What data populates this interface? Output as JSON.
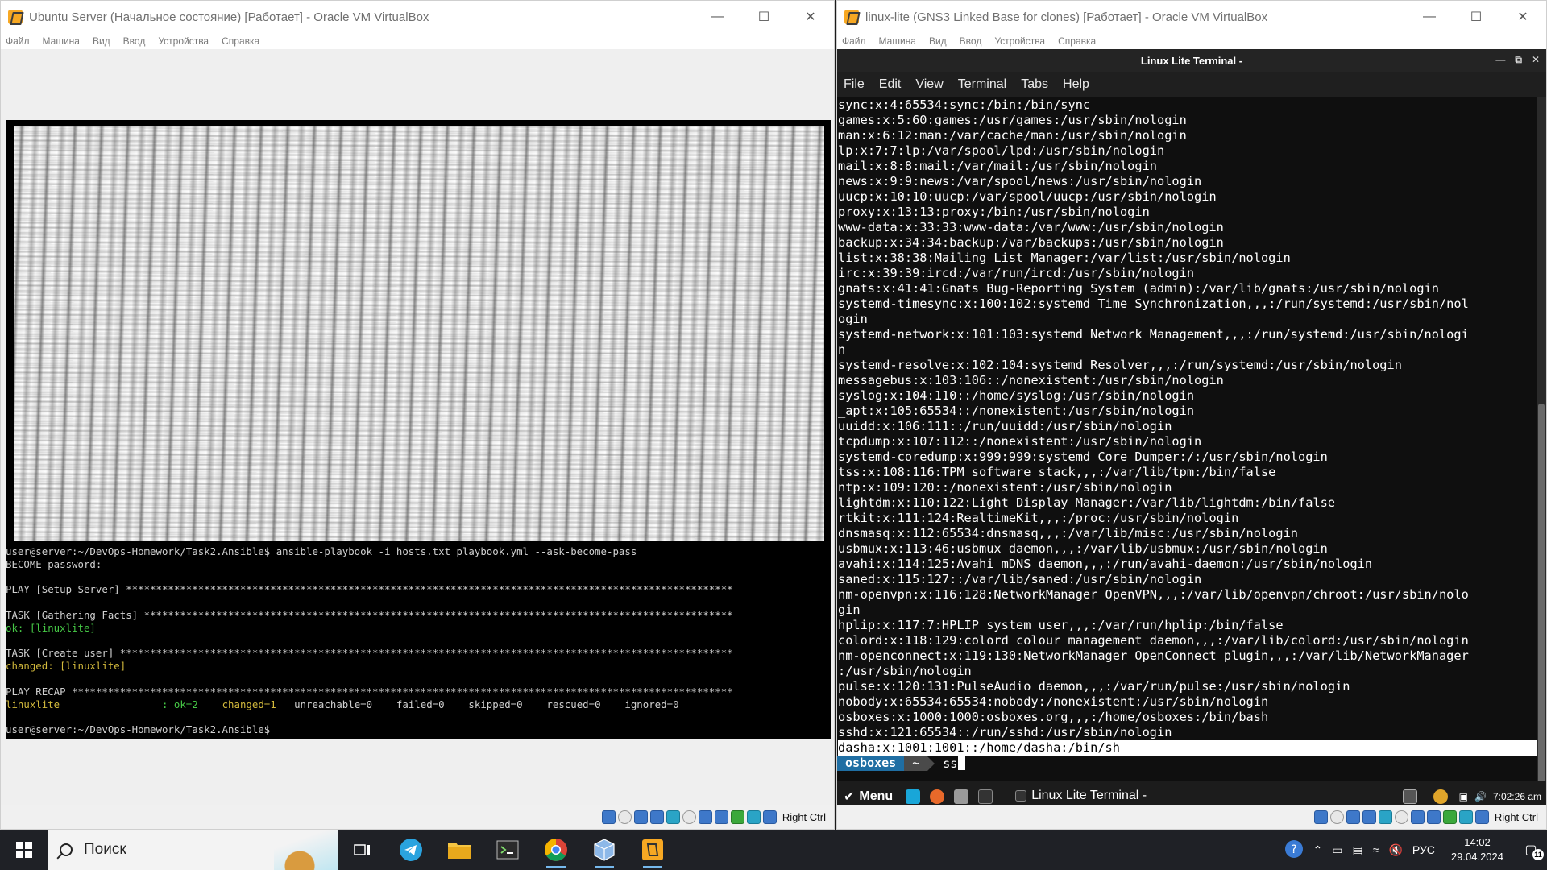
{
  "left_window": {
    "title": "Ubuntu Server (Начальное состояние) [Работает] - Oracle VM VirtualBox",
    "menu": [
      "Файл",
      "Машина",
      "Вид",
      "Ввод",
      "Устройства",
      "Справка"
    ],
    "status_host_key": "Right Ctrl",
    "console": {
      "line1_prompt": "user@server:~/DevOps-Homework/Task2.Ansible$ ansible-playbook -i hosts.txt playbook.yml --ask-become-pass",
      "line2": "BECOME password:",
      "play": "PLAY [Setup Server] *****************************************************************************************************",
      "task1": "TASK [Gathering Facts] **************************************************************************************************",
      "task1_result": "ok: [linuxlite]",
      "task2": "TASK [Create user] ******************************************************************************************************",
      "task2_result": "changed: [linuxlite]",
      "recap": "PLAY RECAP **************************************************************************************************************",
      "recap_host": "linuxlite",
      "recap_ok": ": ok=2",
      "recap_changed": "changed=1",
      "recap_rest": "   unreachable=0    failed=0    skipped=0    rescued=0    ignored=0",
      "final_prompt": "user@server:~/DevOps-Homework/Task2.Ansible$ "
    }
  },
  "right_window": {
    "title": "linux-lite (GNS3 Linked Base for clones) [Работает] - Oracle VM VirtualBox",
    "menu": [
      "Файл",
      "Машина",
      "Вид",
      "Ввод",
      "Устройства",
      "Справка"
    ],
    "status_host_key": "Right Ctrl",
    "terminal": {
      "title": "Linux Lite Terminal -",
      "menu": [
        "File",
        "Edit",
        "View",
        "Terminal",
        "Tabs",
        "Help"
      ],
      "lines": [
        "sync:x:4:65534:sync:/bin:/bin/sync",
        "games:x:5:60:games:/usr/games:/usr/sbin/nologin",
        "man:x:6:12:man:/var/cache/man:/usr/sbin/nologin",
        "lp:x:7:7:lp:/var/spool/lpd:/usr/sbin/nologin",
        "mail:x:8:8:mail:/var/mail:/usr/sbin/nologin",
        "news:x:9:9:news:/var/spool/news:/usr/sbin/nologin",
        "uucp:x:10:10:uucp:/var/spool/uucp:/usr/sbin/nologin",
        "proxy:x:13:13:proxy:/bin:/usr/sbin/nologin",
        "www-data:x:33:33:www-data:/var/www:/usr/sbin/nologin",
        "backup:x:34:34:backup:/var/backups:/usr/sbin/nologin",
        "list:x:38:38:Mailing List Manager:/var/list:/usr/sbin/nologin",
        "irc:x:39:39:ircd:/var/run/ircd:/usr/sbin/nologin",
        "gnats:x:41:41:Gnats Bug-Reporting System (admin):/var/lib/gnats:/usr/sbin/nologin",
        "systemd-timesync:x:100:102:systemd Time Synchronization,,,:/run/systemd:/usr/sbin/nol",
        "ogin",
        "systemd-network:x:101:103:systemd Network Management,,,:/run/systemd:/usr/sbin/nologi",
        "n",
        "systemd-resolve:x:102:104:systemd Resolver,,,:/run/systemd:/usr/sbin/nologin",
        "messagebus:x:103:106::/nonexistent:/usr/sbin/nologin",
        "syslog:x:104:110::/home/syslog:/usr/sbin/nologin",
        "_apt:x:105:65534::/nonexistent:/usr/sbin/nologin",
        "uuidd:x:106:111::/run/uuidd:/usr/sbin/nologin",
        "tcpdump:x:107:112::/nonexistent:/usr/sbin/nologin",
        "systemd-coredump:x:999:999:systemd Core Dumper:/:/usr/sbin/nologin",
        "tss:x:108:116:TPM software stack,,,:/var/lib/tpm:/bin/false",
        "ntp:x:109:120::/nonexistent:/usr/sbin/nologin",
        "lightdm:x:110:122:Light Display Manager:/var/lib/lightdm:/bin/false",
        "rtkit:x:111:124:RealtimeKit,,,:/proc:/usr/sbin/nologin",
        "dnsmasq:x:112:65534:dnsmasq,,,:/var/lib/misc:/usr/sbin/nologin",
        "usbmux:x:113:46:usbmux daemon,,,:/var/lib/usbmux:/usr/sbin/nologin",
        "avahi:x:114:125:Avahi mDNS daemon,,,:/run/avahi-daemon:/usr/sbin/nologin",
        "saned:x:115:127::/var/lib/saned:/usr/sbin/nologin",
        "nm-openvpn:x:116:128:NetworkManager OpenVPN,,,:/var/lib/openvpn/chroot:/usr/sbin/nolo",
        "gin",
        "hplip:x:117:7:HPLIP system user,,,:/var/run/hplip:/bin/false",
        "colord:x:118:129:colord colour management daemon,,,:/var/lib/colord:/usr/sbin/nologin",
        "nm-openconnect:x:119:130:NetworkManager OpenConnect plugin,,,:/var/lib/NetworkManager",
        ":/usr/sbin/nologin",
        "pulse:x:120:131:PulseAudio daemon,,,:/var/run/pulse:/usr/sbin/nologin",
        "nobody:x:65534:65534:nobody:/nonexistent:/usr/sbin/nologin",
        "osboxes:x:1000:1000:osboxes.org,,,:/home/osboxes:/bin/bash",
        "sshd:x:121:65534::/run/sshd:/usr/sbin/nologin"
      ],
      "highlighted_line": "dasha:x:1001:1001::/home/dasha:/bin/sh",
      "prompt_user": "osboxes",
      "prompt_dir": "~",
      "prompt_input": "ss"
    },
    "panel": {
      "menu_label": "Menu",
      "task_label": "Linux Lite Terminal -",
      "clock": "7:02:26 am"
    }
  },
  "taskbar": {
    "search_placeholder": "Поиск",
    "language": "РУС",
    "time": "14:02",
    "date": "29.04.2024",
    "notification_count": "11"
  }
}
